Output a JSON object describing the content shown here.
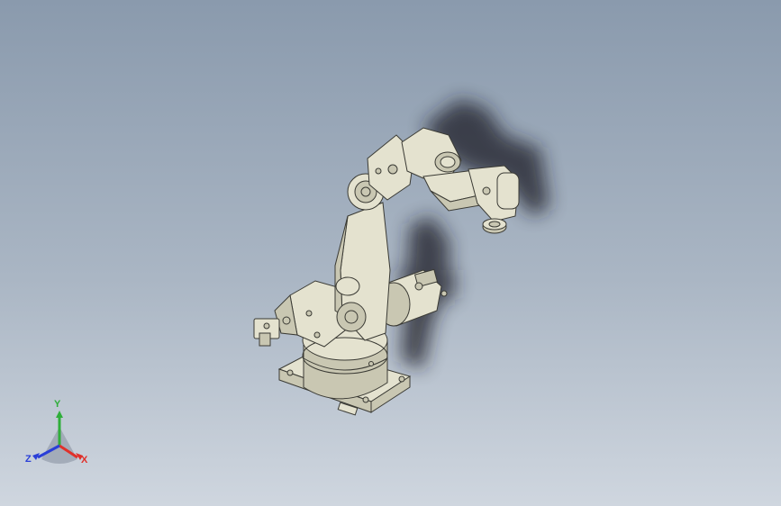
{
  "colors": {
    "bg_top": "#8a9aad",
    "bg_mid": "#aab6c4",
    "bg_bot": "#cfd6df",
    "robot_body": "#e4e2cf",
    "robot_shade": "#c9c7b2",
    "robot_edge": "#3a3a34",
    "shadow": "#1a1f28",
    "axis_x": "#e0302a",
    "axis_y": "#2fae3a",
    "axis_z": "#2a3fd8"
  },
  "triad": {
    "x_label": "X",
    "y_label": "Y",
    "z_label": "Z"
  }
}
